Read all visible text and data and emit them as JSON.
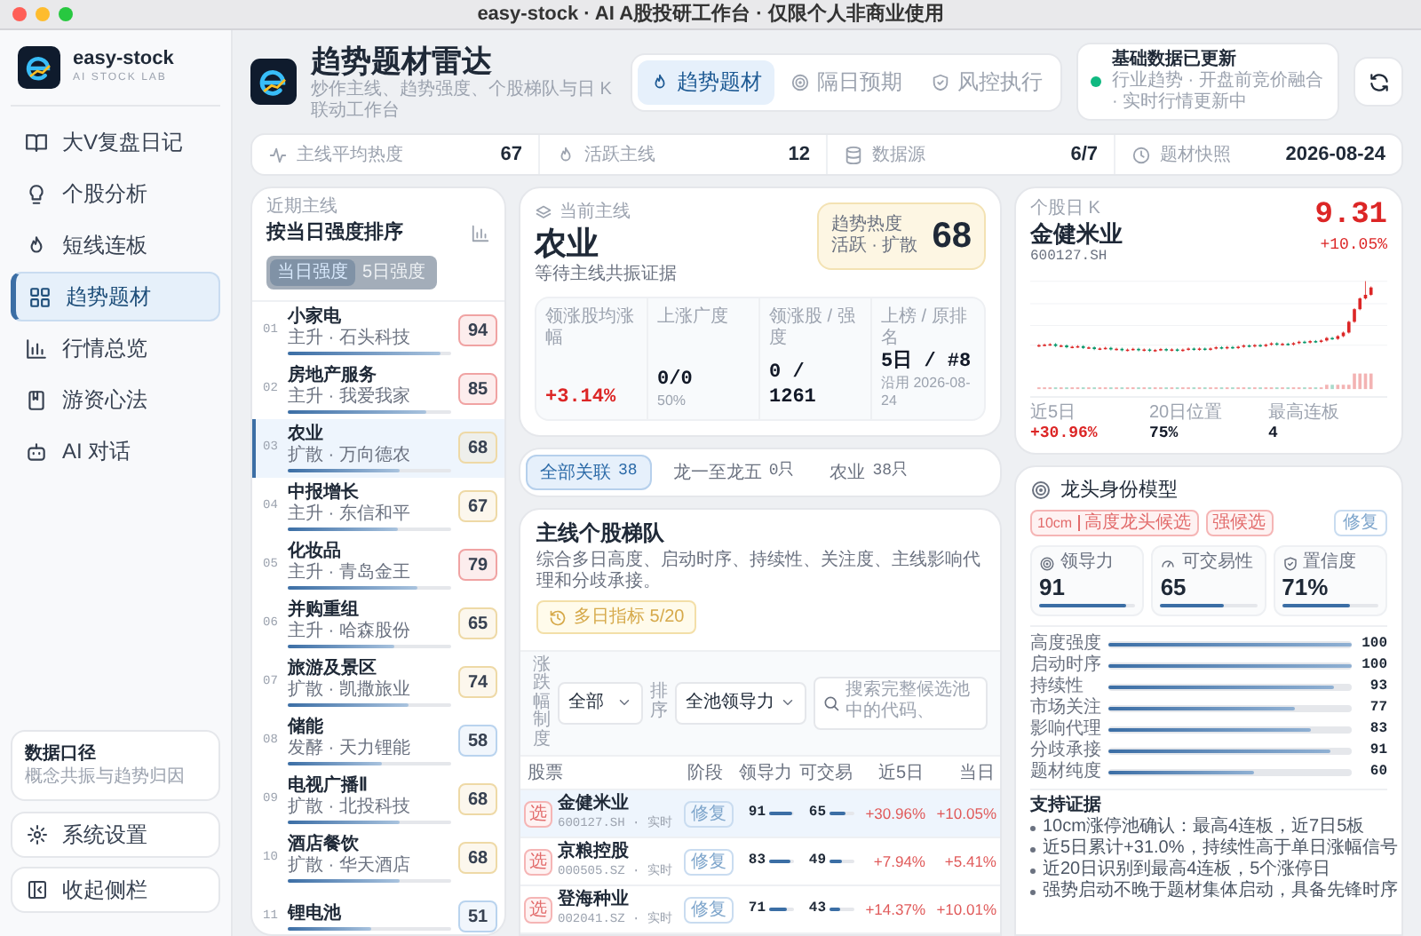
{
  "window": {
    "title": "easy-stock · AI A股投研工作台 · 仅限个人非商业使用"
  },
  "sidebar": {
    "brand": {
      "name": "easy-stock",
      "tagline": "AI STOCK LAB"
    },
    "items": [
      {
        "label": "大V复盘日记",
        "selected": false
      },
      {
        "label": "个股分析",
        "selected": false
      },
      {
        "label": "短线连板",
        "selected": false
      },
      {
        "label": "趋势题材",
        "selected": true
      },
      {
        "label": "行情总览",
        "selected": false
      },
      {
        "label": "游资心法",
        "selected": false
      },
      {
        "label": "AI 对话",
        "selected": false
      }
    ],
    "info_card": {
      "title": "数据口径",
      "text": "概念共振与趋势归因"
    },
    "footer_items": [
      "系统设置",
      "收起侧栏"
    ]
  },
  "header": {
    "title": "趋势题材雷达",
    "subtitle": "炒作主线、趋势强度、个股梯队与日 K 联动工作台",
    "tabs": [
      {
        "label": "趋势题材",
        "selected": true
      },
      {
        "label": "隔日预期",
        "selected": false
      },
      {
        "label": "风控执行",
        "selected": false
      }
    ],
    "status": {
      "title": "基础数据已更新",
      "detail": "行业趋势 · 开盘前竞价融合 · 实时行情更新中"
    }
  },
  "stats": [
    {
      "label": "主线平均热度",
      "value": "67"
    },
    {
      "label": "活跃主线",
      "value": "12"
    },
    {
      "label": "数据源",
      "value": "6/7"
    },
    {
      "label": "题材快照",
      "value": "2026-08-24"
    }
  ],
  "theme_list": {
    "caption": "近期主线",
    "title": "按当日强度排序",
    "sort_options": [
      {
        "label": "当日强度",
        "selected": true
      },
      {
        "label": "5日强度",
        "selected": false
      }
    ],
    "items": [
      {
        "rank": "01",
        "name": "小家电",
        "sub": "主升 · 石头科技",
        "score": "94",
        "level": 0.94,
        "color": "#f0a3a3",
        "selected": false
      },
      {
        "rank": "02",
        "name": "房地产服务",
        "sub": "主升 · 我爱我家",
        "score": "85",
        "level": 0.85,
        "color": "#f0a3a3",
        "selected": false
      },
      {
        "rank": "03",
        "name": "农业",
        "sub": "扩散 · 万向德农",
        "score": "68",
        "level": 0.68,
        "color": "#eed9a6",
        "selected": true
      },
      {
        "rank": "04",
        "name": "中报增长",
        "sub": "主升 · 东信和平",
        "score": "67",
        "level": 0.67,
        "color": "#eed9a6",
        "selected": false
      },
      {
        "rank": "05",
        "name": "化妆品",
        "sub": "主升 · 青岛金王",
        "score": "79",
        "level": 0.79,
        "color": "#f0a3a3",
        "selected": false
      },
      {
        "rank": "06",
        "name": "并购重组",
        "sub": "主升 · 哈森股份",
        "score": "65",
        "level": 0.65,
        "color": "#eed9a6",
        "selected": false
      },
      {
        "rank": "07",
        "name": "旅游及景区",
        "sub": "扩散 · 凯撒旅业",
        "score": "74",
        "level": 0.74,
        "color": "#eed9a6",
        "selected": false
      },
      {
        "rank": "08",
        "name": "储能",
        "sub": "发酵 · 天力锂能",
        "score": "58",
        "level": 0.58,
        "color": "#b9d3ee",
        "selected": false
      },
      {
        "rank": "09",
        "name": "电视广播Ⅱ",
        "sub": "扩散 · 北投科技",
        "score": "68",
        "level": 0.68,
        "color": "#eed9a6",
        "selected": false
      },
      {
        "rank": "10",
        "name": "酒店餐饮",
        "sub": "扩散 · 华天酒店",
        "score": "68",
        "level": 0.68,
        "color": "#eed9a6",
        "selected": false
      },
      {
        "rank": "11",
        "name": "锂电池",
        "score": "51",
        "level": 0.51,
        "color": "#b9d3ee",
        "selected": false
      }
    ]
  },
  "current_theme": {
    "caption": "当前主线",
    "name": "农业",
    "note": "等待主线共振证据",
    "heat": {
      "label": "趋势热度",
      "sub": "活跃 · 扩散",
      "value": "68"
    },
    "metrics": [
      {
        "label": "领涨股均涨幅",
        "value": "+3.14%",
        "kind": "up"
      },
      {
        "label": "上涨广度",
        "value": "0/0",
        "extra": "50%",
        "kind": "plain"
      },
      {
        "label": "领涨股 / 强度",
        "value": "0 / 1261",
        "kind": "plain"
      },
      {
        "label": "上榜 / 原排名",
        "value": "5日 / #8",
        "extra": "沿用 2026-08-24",
        "kind": "plain"
      }
    ]
  },
  "filters": [
    {
      "label": "全部关联",
      "count": "38",
      "selected": true
    },
    {
      "label": "龙一至龙五",
      "count": "0只",
      "selected": false
    },
    {
      "label": "农业",
      "count": "38只",
      "selected": false
    }
  ],
  "ladder": {
    "title": "主线个股梯队",
    "description": "综合多日高度、启动时序、持续性、关注度、主线影响代理和分歧承接。",
    "history_button": "多日指标 5/20",
    "rule_select": {
      "label": "涨跌幅制度",
      "value": "全部"
    },
    "sort_select": {
      "label": "排序",
      "value": "全池领导力"
    },
    "search": {
      "placeholder": "搜索完整候选池中的代码、"
    },
    "columns": [
      "股票",
      "阶段",
      "领导力",
      "可交易",
      "近5日",
      "当日"
    ],
    "rows": [
      {
        "tag": "选",
        "name": "金健米业",
        "code": "600127.SH · 实时",
        "stage": "修复",
        "leadership": {
          "value": "91",
          "level": 0.91
        },
        "tradable": {
          "value": "65",
          "level": 0.65
        },
        "change_5d": "+30.96%",
        "change_today": "+10.05%",
        "selected": true
      },
      {
        "tag": "选",
        "name": "京粮控股",
        "code": "000505.SZ · 实时",
        "stage": "修复",
        "leadership": {
          "value": "83",
          "level": 0.83
        },
        "tradable": {
          "value": "49",
          "level": 0.49
        },
        "change_5d": "+7.94%",
        "change_today": "+5.41%",
        "selected": false
      },
      {
        "tag": "选",
        "name": "登海种业",
        "code": "002041.SZ · 实时",
        "stage": "修复",
        "leadership": {
          "value": "71",
          "level": 0.71
        },
        "tradable": {
          "value": "43",
          "level": 0.43
        },
        "change_5d": "+14.37%",
        "change_today": "+10.01%",
        "selected": false
      }
    ]
  },
  "stock_chart": {
    "caption": "个股日 K",
    "name": "金健米业",
    "code": "600127.SH",
    "price": "9.31",
    "change": "+10.05%",
    "stats": [
      {
        "label": "近5日",
        "value": "+30.96%",
        "kind": "up"
      },
      {
        "label": "20日位置",
        "value": "75%",
        "kind": "plain"
      },
      {
        "label": "最高连板",
        "value": "4",
        "kind": "plain"
      }
    ]
  },
  "dragon_model": {
    "title": "龙头身份模型",
    "limit_tag": {
      "rule": "10cm",
      "label": "高度龙头候选"
    },
    "grade_tag": "强候选",
    "stage_button": "修复",
    "metrics": [
      {
        "label": "领导力",
        "value": "91",
        "level": 0.91
      },
      {
        "label": "可交易性",
        "value": "65",
        "level": 0.65
      },
      {
        "label": "置信度",
        "value": "71%",
        "level": 0.71
      }
    ],
    "factors": [
      {
        "label": "高度强度",
        "value": "100",
        "level": 1
      },
      {
        "label": "启动时序",
        "value": "100",
        "level": 1
      },
      {
        "label": "持续性",
        "value": "93",
        "level": 0.93
      },
      {
        "label": "市场关注",
        "value": "77",
        "level": 0.77
      },
      {
        "label": "影响代理",
        "value": "83",
        "level": 0.83
      },
      {
        "label": "分歧承接",
        "value": "91",
        "level": 0.91
      },
      {
        "label": "题材纯度",
        "value": "60",
        "level": 0.6
      }
    ],
    "evidence_title": "支持证据",
    "evidence": [
      "10cm涨停池确认：最高4连板，近7日5板",
      "近5日累计+31.0%，持续性高于单日涨幅信号",
      "近20日识别到最高4连板，5个涨停日",
      "强势启动不晚于题材集体启动，具备先锋时序"
    ]
  }
}
